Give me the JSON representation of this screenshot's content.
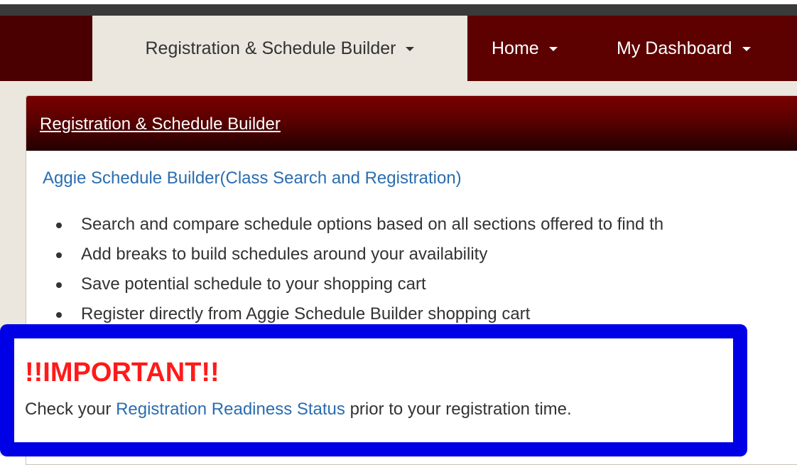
{
  "nav": {
    "tabs": [
      {
        "label": "Registration & Schedule Builder"
      },
      {
        "label": "Home"
      },
      {
        "label": "My Dashboard"
      }
    ]
  },
  "panel": {
    "title": "Registration & Schedule Builder",
    "asb_link": "Aggie Schedule Builder(Class Search and Registration)",
    "bullets": [
      "Search and compare schedule options based on all sections offered to find th",
      "Add breaks to build schedules around your availability",
      "Save potential schedule to your shopping cart",
      "Register directly from Aggie Schedule Builder shopping cart"
    ]
  },
  "notice": {
    "heading": "!!IMPORTANT!!",
    "before": "Check your ",
    "link": "Registration Readiness Status",
    "after": " prior to your registration time."
  },
  "colors": {
    "nav_bg": "#5c0000",
    "active_tab_bg": "#ebe7df",
    "link": "#2a6db0",
    "important": "#ff1a1a",
    "highlight_border": "#0000e6"
  }
}
